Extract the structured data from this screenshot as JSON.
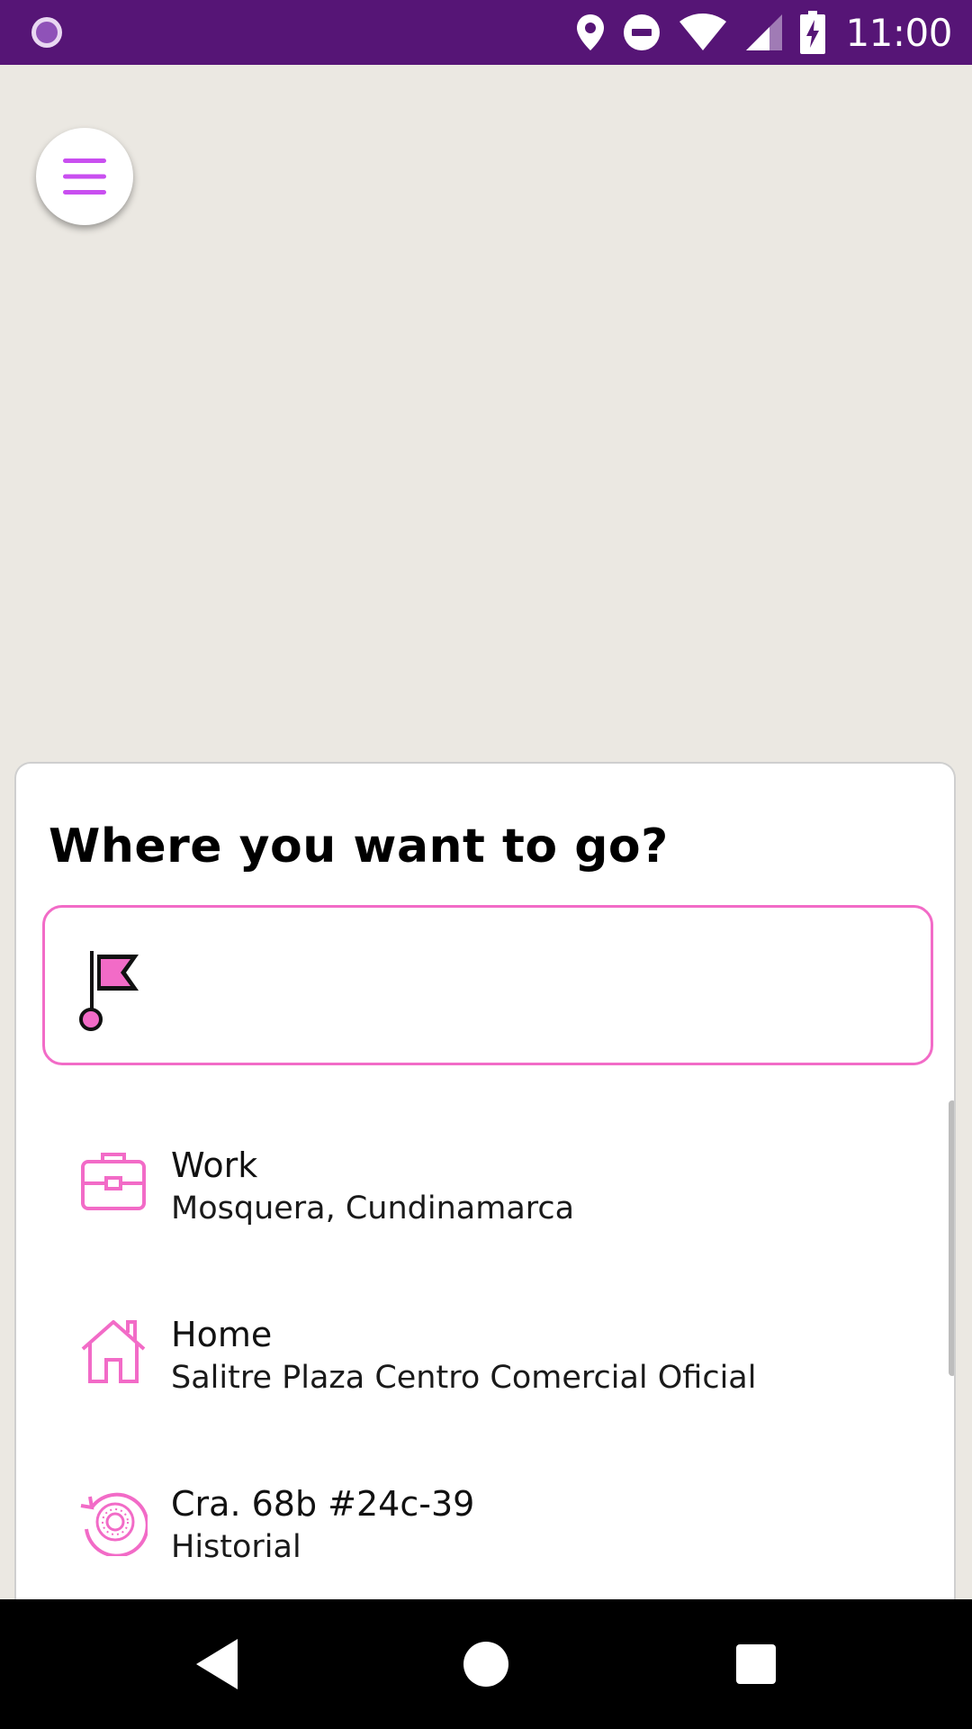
{
  "status_bar": {
    "time": "11:00",
    "icons": [
      "app-notification-icon",
      "location-icon",
      "do-not-disturb-icon",
      "wifi-icon",
      "cellular-signal-icon",
      "battery-charging-icon"
    ]
  },
  "map": {
    "background_color": "#ebe8e2"
  },
  "menu_button": {
    "icon": "hamburger-menu-icon",
    "color": "#c94ff0"
  },
  "destination_sheet": {
    "title": "Where you want to go?",
    "search": {
      "value": "",
      "placeholder": "",
      "icon": "flag-icon"
    },
    "items": [
      {
        "icon": "briefcase-icon",
        "title": "Work",
        "subtitle": "Mosquera, Cundinamarca"
      },
      {
        "icon": "house-icon",
        "title": "Home",
        "subtitle": "Salitre Plaza Centro Comercial Oficial"
      },
      {
        "icon": "history-icon",
        "title": "Cra. 68b #24c-39",
        "subtitle": "Historial"
      }
    ]
  },
  "nav_bar": {
    "buttons": [
      "back-icon",
      "home-icon",
      "recents-icon"
    ]
  },
  "colors": {
    "status_bar": "#561576",
    "accent_pink": "#f26bc7",
    "menu_purple": "#c94ff0"
  }
}
